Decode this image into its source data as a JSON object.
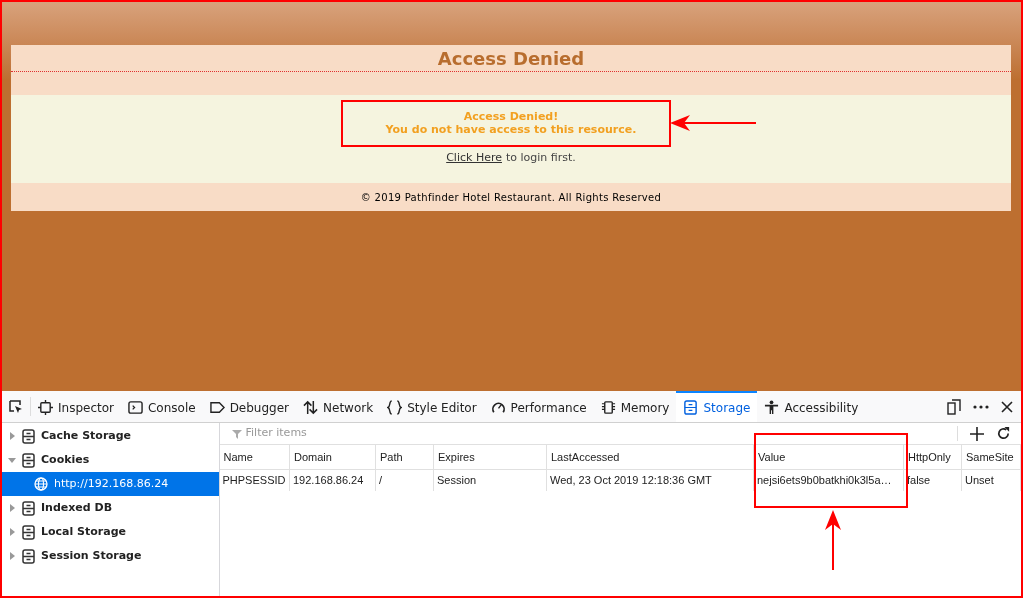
{
  "page": {
    "title": "Access Denied",
    "message": [
      "Access Denied!",
      "You do not have access to this resource."
    ],
    "login_link": "Click Here",
    "login_text": "to login first.",
    "footer": "© 2019 Pathfinder Hotel Restaurant. All Rights Reserved"
  },
  "devtools": {
    "tabs": [
      {
        "label": "Inspector",
        "selected": false
      },
      {
        "label": "Console",
        "selected": false
      },
      {
        "label": "Debugger",
        "selected": false
      },
      {
        "label": "Network",
        "selected": false
      },
      {
        "label": "Style Editor",
        "selected": false
      },
      {
        "label": "Performance",
        "selected": false
      },
      {
        "label": "Memory",
        "selected": false
      },
      {
        "label": "Storage",
        "selected": true
      },
      {
        "label": "Accessibility",
        "selected": false
      }
    ],
    "sidebar": [
      {
        "label": "Cache Storage",
        "expanded": false,
        "selected": false
      },
      {
        "label": "Cookies",
        "expanded": true,
        "selected": false,
        "children": [
          {
            "label": "http://192.168.86.24",
            "selected": true
          }
        ]
      },
      {
        "label": "Indexed DB",
        "expanded": false,
        "selected": false
      },
      {
        "label": "Local Storage",
        "expanded": false,
        "selected": false
      },
      {
        "label": "Session Storage",
        "expanded": false,
        "selected": false
      }
    ],
    "filter": {
      "placeholder": "Filter items"
    },
    "table": {
      "columns": [
        "Name",
        "Domain",
        "Path",
        "Expires",
        "LastAccessed",
        "Value",
        "HttpOnly",
        "SameSite"
      ],
      "rows": [
        [
          "PHPSESSID",
          "192.168.86.24",
          "/",
          "Session",
          "Wed, 23 Oct 2019 12:18:36 GMT",
          "nejsi6ets9b0batkhi0k3l5a…",
          "false",
          "Unset"
        ]
      ]
    }
  }
}
